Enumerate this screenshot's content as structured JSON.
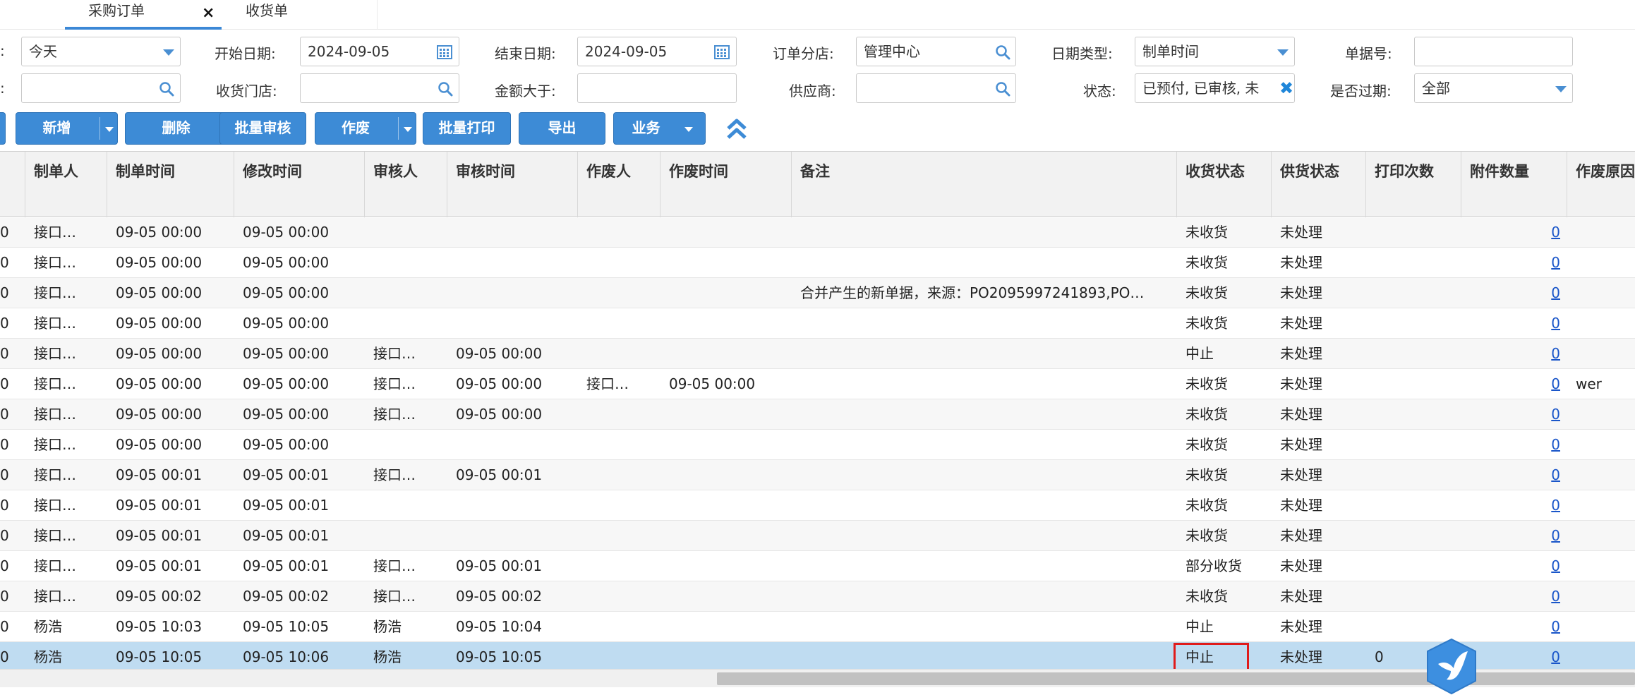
{
  "tabs": [
    {
      "label": "采购订单",
      "close": "×",
      "active": true
    },
    {
      "label": "收货单",
      "active": false
    }
  ],
  "filters": {
    "row1": {
      "date_range_label": ":",
      "date_range_value": "今天",
      "start_date_label": "开始日期:",
      "start_date_value": "2024-09-05",
      "end_date_label": "结束日期:",
      "end_date_value": "2024-09-05",
      "branch_label": "订单分店:",
      "branch_value": "管理中心",
      "date_type_label": "日期类型:",
      "date_type_value": "制单时间",
      "doc_no_label": "单据号:",
      "doc_no_value": ""
    },
    "row2": {
      "first_label": ":",
      "first_value": "",
      "store_label": "收货门店:",
      "store_value": "",
      "amount_label": "金额大于:",
      "amount_value": "",
      "supplier_label": "供应商:",
      "supplier_value": "",
      "status_label": "状态:",
      "status_value": "已预付, 已审核, 未",
      "expired_label": "是否过期:",
      "expired_value": "全部"
    }
  },
  "toolbar": {
    "add": "新增",
    "delete": "删除",
    "batch_audit": "批量审核",
    "void": "作废",
    "batch_print": "批量打印",
    "export": "导出",
    "business": "业务"
  },
  "colors": {
    "accent": "#3d8bd6",
    "selected_row": "#bfdcf1",
    "highlight": "#e01b1b",
    "link": "#1a56c9"
  },
  "table": {
    "headers": {
      "creator": "制单人",
      "created_time": "制单时间",
      "modified_time": "修改时间",
      "auditor": "审核人",
      "audit_time": "审核时间",
      "voider": "作废人",
      "void_time": "作废时间",
      "remark": "备注",
      "receive_status": "收货状态",
      "supply_status": "供货状态",
      "print_count": "打印次数",
      "attachments": "附件数量",
      "void_reason": "作废原因"
    },
    "rows": [
      {
        "lead": "0",
        "creator": "接口…",
        "created_time": "09-05 00:00",
        "modified_time": "09-05 00:00",
        "auditor": "",
        "audit_time": "",
        "voider": "",
        "void_time": "",
        "remark": "",
        "receive_status": "未收货",
        "supply_status": "未处理",
        "print_count": "",
        "attachments": "0",
        "void_reason": ""
      },
      {
        "lead": "0",
        "creator": "接口…",
        "created_time": "09-05 00:00",
        "modified_time": "09-05 00:00",
        "auditor": "",
        "audit_time": "",
        "voider": "",
        "void_time": "",
        "remark": "",
        "receive_status": "未收货",
        "supply_status": "未处理",
        "print_count": "",
        "attachments": "0",
        "void_reason": ""
      },
      {
        "lead": "0",
        "creator": "接口…",
        "created_time": "09-05 00:00",
        "modified_time": "09-05 00:00",
        "auditor": "",
        "audit_time": "",
        "voider": "",
        "void_time": "",
        "remark": "合并产生的新单据，来源：PO2095997241893,PO…",
        "receive_status": "未收货",
        "supply_status": "未处理",
        "print_count": "",
        "attachments": "0",
        "void_reason": ""
      },
      {
        "lead": "0",
        "creator": "接口…",
        "created_time": "09-05 00:00",
        "modified_time": "09-05 00:00",
        "auditor": "",
        "audit_time": "",
        "voider": "",
        "void_time": "",
        "remark": "",
        "receive_status": "未收货",
        "supply_status": "未处理",
        "print_count": "",
        "attachments": "0",
        "void_reason": ""
      },
      {
        "lead": "0",
        "creator": "接口…",
        "created_time": "09-05 00:00",
        "modified_time": "09-05 00:00",
        "auditor": "接口…",
        "audit_time": "09-05 00:00",
        "voider": "",
        "void_time": "",
        "remark": "",
        "receive_status": "中止",
        "supply_status": "未处理",
        "print_count": "",
        "attachments": "0",
        "void_reason": ""
      },
      {
        "lead": "0",
        "creator": "接口…",
        "created_time": "09-05 00:00",
        "modified_time": "09-05 00:00",
        "auditor": "接口…",
        "audit_time": "09-05 00:00",
        "voider": "接口…",
        "void_time": "09-05 00:00",
        "remark": "",
        "receive_status": "未收货",
        "supply_status": "未处理",
        "print_count": "",
        "attachments": "0",
        "void_reason": "wer"
      },
      {
        "lead": "0",
        "creator": "接口…",
        "created_time": "09-05 00:00",
        "modified_time": "09-05 00:00",
        "auditor": "接口…",
        "audit_time": "09-05 00:00",
        "voider": "",
        "void_time": "",
        "remark": "",
        "receive_status": "未收货",
        "supply_status": "未处理",
        "print_count": "",
        "attachments": "0",
        "void_reason": ""
      },
      {
        "lead": "0",
        "creator": "接口…",
        "created_time": "09-05 00:00",
        "modified_time": "09-05 00:00",
        "auditor": "",
        "audit_time": "",
        "voider": "",
        "void_time": "",
        "remark": "",
        "receive_status": "未收货",
        "supply_status": "未处理",
        "print_count": "",
        "attachments": "0",
        "void_reason": ""
      },
      {
        "lead": "0",
        "creator": "接口…",
        "created_time": "09-05 00:01",
        "modified_time": "09-05 00:01",
        "auditor": "接口…",
        "audit_time": "09-05 00:01",
        "voider": "",
        "void_time": "",
        "remark": "",
        "receive_status": "未收货",
        "supply_status": "未处理",
        "print_count": "",
        "attachments": "0",
        "void_reason": ""
      },
      {
        "lead": "0",
        "creator": "接口…",
        "created_time": "09-05 00:01",
        "modified_time": "09-05 00:01",
        "auditor": "",
        "audit_time": "",
        "voider": "",
        "void_time": "",
        "remark": "",
        "receive_status": "未收货",
        "supply_status": "未处理",
        "print_count": "",
        "attachments": "0",
        "void_reason": ""
      },
      {
        "lead": "0",
        "creator": "接口…",
        "created_time": "09-05 00:01",
        "modified_time": "09-05 00:01",
        "auditor": "",
        "audit_time": "",
        "voider": "",
        "void_time": "",
        "remark": "",
        "receive_status": "未收货",
        "supply_status": "未处理",
        "print_count": "",
        "attachments": "0",
        "void_reason": ""
      },
      {
        "lead": "0",
        "creator": "接口…",
        "created_time": "09-05 00:01",
        "modified_time": "09-05 00:01",
        "auditor": "接口…",
        "audit_time": "09-05 00:01",
        "voider": "",
        "void_time": "",
        "remark": "",
        "receive_status": "部分收货",
        "supply_status": "未处理",
        "print_count": "",
        "attachments": "0",
        "void_reason": ""
      },
      {
        "lead": "0",
        "creator": "接口…",
        "created_time": "09-05 00:02",
        "modified_time": "09-05 00:02",
        "auditor": "接口…",
        "audit_time": "09-05 00:02",
        "voider": "",
        "void_time": "",
        "remark": "",
        "receive_status": "未收货",
        "supply_status": "未处理",
        "print_count": "",
        "attachments": "0",
        "void_reason": ""
      },
      {
        "lead": "0",
        "creator": "杨浩",
        "created_time": "09-05 10:03",
        "modified_time": "09-05 10:05",
        "auditor": "杨浩",
        "audit_time": "09-05 10:04",
        "voider": "",
        "void_time": "",
        "remark": "",
        "receive_status": "中止",
        "supply_status": "未处理",
        "print_count": "",
        "attachments": "0",
        "void_reason": ""
      },
      {
        "lead": "0",
        "creator": "杨浩",
        "created_time": "09-05 10:05",
        "modified_time": "09-05 10:06",
        "auditor": "杨浩",
        "audit_time": "09-05 10:05",
        "voider": "",
        "void_time": "",
        "remark": "",
        "receive_status": "中止",
        "supply_status": "未处理",
        "print_count": "0",
        "attachments": "0",
        "void_reason": "",
        "selected": true
      }
    ]
  }
}
